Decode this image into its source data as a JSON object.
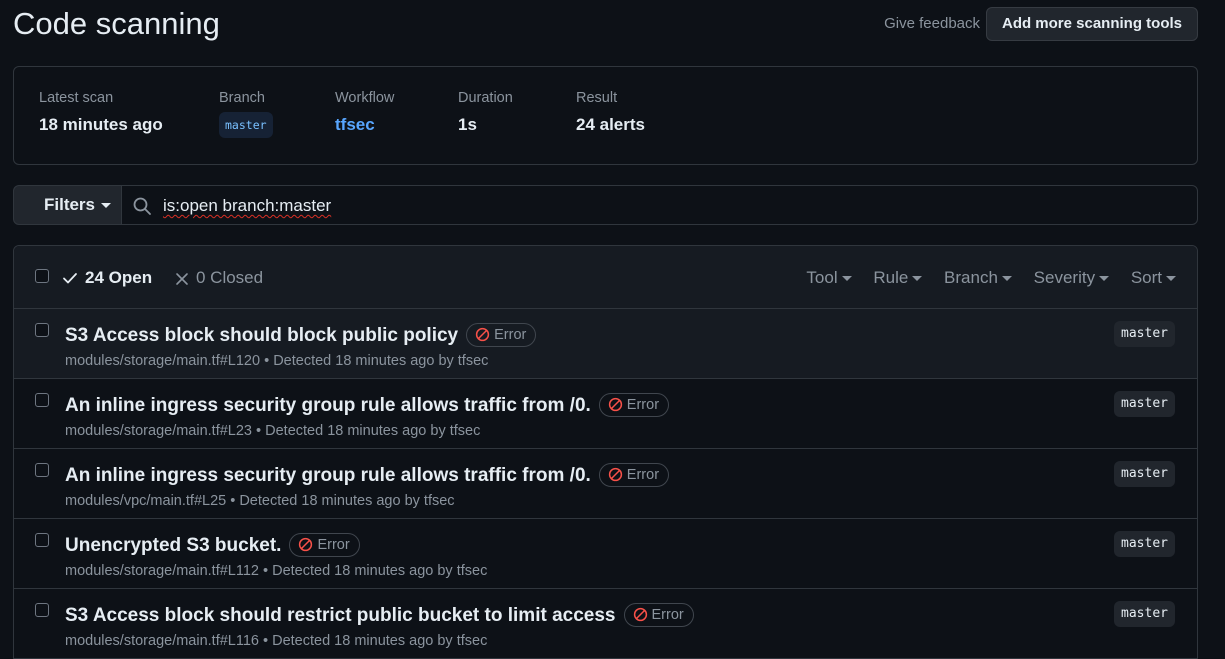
{
  "header": {
    "title": "Code scanning",
    "feedback_label": "Give feedback",
    "add_tools_label": "Add more scanning tools"
  },
  "scan": {
    "latest_label": "Latest scan",
    "latest_value": "18 minutes ago",
    "branch_label": "Branch",
    "branch_value": "master",
    "workflow_label": "Workflow",
    "workflow_value": "tfsec",
    "duration_label": "Duration",
    "duration_value": "1s",
    "result_label": "Result",
    "result_value": "24 alerts"
  },
  "filters": {
    "button_label": "Filters",
    "query": "is:open branch:master"
  },
  "alerts_header": {
    "open_label": "24 Open",
    "closed_label": "0 Closed",
    "menus": [
      "Tool",
      "Rule",
      "Branch",
      "Severity",
      "Sort"
    ]
  },
  "alerts": [
    {
      "title": "S3 Access block should block public policy",
      "severity": "Error",
      "meta": "modules/storage/main.tf#L120 • Detected 18 minutes ago by tfsec",
      "branch": "master"
    },
    {
      "title": "An inline ingress security group rule allows traffic from /0.",
      "severity": "Error",
      "meta": "modules/storage/main.tf#L23 • Detected 18 minutes ago by tfsec",
      "branch": "master"
    },
    {
      "title": "An inline ingress security group rule allows traffic from /0.",
      "severity": "Error",
      "meta": "modules/vpc/main.tf#L25 • Detected 18 minutes ago by tfsec",
      "branch": "master"
    },
    {
      "title": "Unencrypted S3 bucket.",
      "severity": "Error",
      "meta": "modules/storage/main.tf#L112 • Detected 18 minutes ago by tfsec",
      "branch": "master"
    },
    {
      "title": "S3 Access block should restrict public bucket to limit access",
      "severity": "Error",
      "meta": "modules/storage/main.tf#L116 • Detected 18 minutes ago by tfsec",
      "branch": "master"
    }
  ]
}
